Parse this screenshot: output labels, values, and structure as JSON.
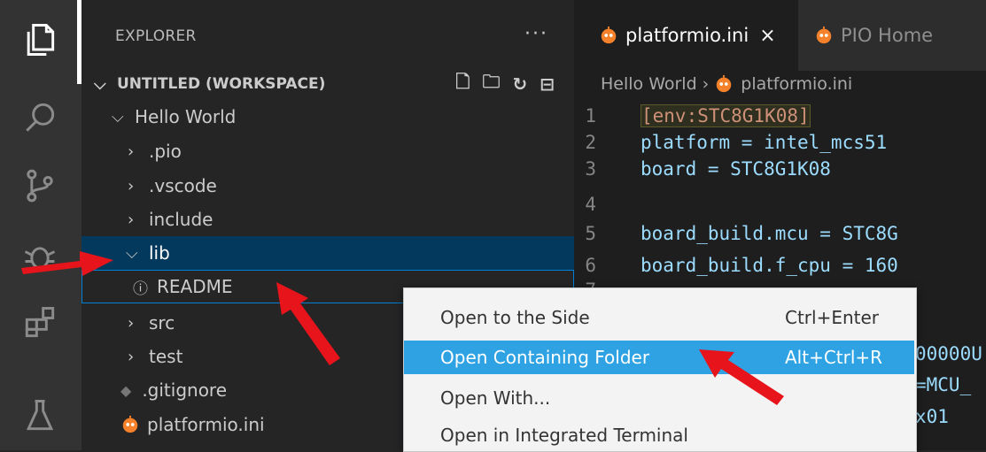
{
  "explorer": {
    "header": "EXPLORER",
    "more": "···",
    "workspace_label": "UNTITLED (WORKSPACE)",
    "project": "Hello World",
    "items": [
      {
        "label": ".pio",
        "type": "folder"
      },
      {
        "label": ".vscode",
        "type": "folder"
      },
      {
        "label": "include",
        "type": "folder"
      },
      {
        "label": "lib",
        "type": "folder-open"
      },
      {
        "label": "README",
        "type": "info-file"
      },
      {
        "label": "src",
        "type": "folder"
      },
      {
        "label": "test",
        "type": "folder"
      },
      {
        "label": ".gitignore",
        "type": "git-file"
      },
      {
        "label": "platformio.ini",
        "type": "pio-file"
      }
    ]
  },
  "tabs": [
    {
      "label": "platformio.ini",
      "close": "×",
      "active": true
    },
    {
      "label": "PIO Home",
      "active": false
    }
  ],
  "breadcrumb": {
    "folder": "Hello World",
    "sep": "›",
    "file": "platformio.ini"
  },
  "code": [
    {
      "n": "1",
      "text": "[env:STC8G1K08]"
    },
    {
      "n": "2",
      "text": "platform = intel_mcs51"
    },
    {
      "n": "3",
      "text": "board = STC8G1K08"
    },
    {
      "n": "4",
      "text": ""
    },
    {
      "n": "5",
      "text": "board_build.mcu = STC8G"
    },
    {
      "n": "6",
      "text": "board_build.f_cpu = 160"
    },
    {
      "n": "7",
      "text": ""
    }
  ],
  "code_tail": {
    "l9": "00000U",
    "l10": "=MCU_",
    "l11": "x01"
  },
  "context_menu": [
    {
      "label": "Open to the Side",
      "shortcut": "Ctrl+Enter",
      "selected": false
    },
    {
      "label": "Open Containing Folder",
      "shortcut": "Alt+Ctrl+R",
      "selected": true
    },
    {
      "label": "Open With...",
      "shortcut": "",
      "selected": false
    },
    {
      "label": "Open in Integrated Terminal",
      "shortcut": "",
      "selected": false
    }
  ],
  "colors": {
    "accent": "#007fd4",
    "selection": "#04395e",
    "menu_highlight": "#2ea2e3",
    "arrow": "#e8141b",
    "pio_orange": "#f5822a"
  }
}
